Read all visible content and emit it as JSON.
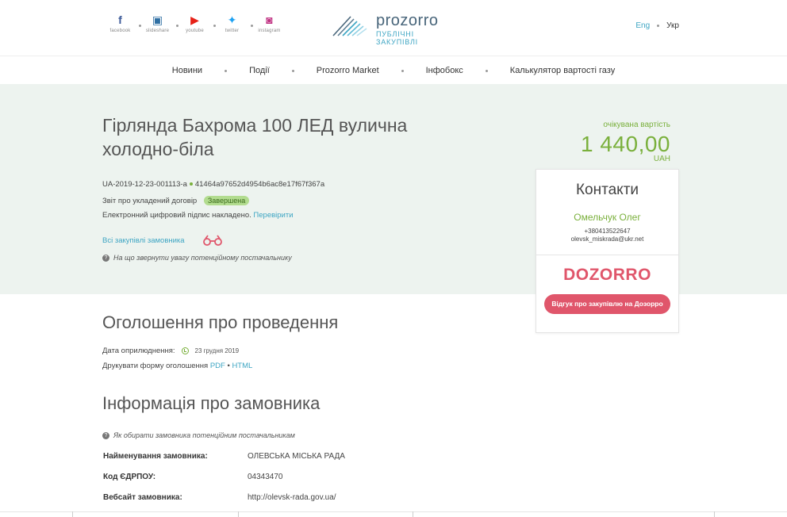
{
  "header": {
    "social": [
      {
        "icon": "facebook-icon",
        "glyph": "f",
        "label": "facebook",
        "color": "#3b5998"
      },
      {
        "icon": "slideshare-icon",
        "glyph": "▣",
        "label": "slideshare",
        "color": "#2f6fa3"
      },
      {
        "icon": "youtube-icon",
        "glyph": "▶",
        "label": "youtube",
        "color": "#e62117"
      },
      {
        "icon": "twitter-icon",
        "glyph": "✦",
        "label": "twitter",
        "color": "#1da1f2"
      },
      {
        "icon": "instagram-icon",
        "glyph": "◙",
        "label": "instagram",
        "color": "#c13584"
      }
    ],
    "logo_word": "prozorro",
    "logo_sub": "ПУБЛІЧНІ ЗАКУПІВЛІ",
    "lang_en": "Eng",
    "lang_ua": "Укр"
  },
  "nav": [
    "Новини",
    "Події",
    "Prozorro Market",
    "Інфобокс",
    "Калькулятор вартості газу"
  ],
  "tender": {
    "title": "Гірлянда Бахрома 100 ЛЕД вулична холодно-біла",
    "expected_label": "очікувана вартість",
    "amount": "1 440,00",
    "currency": "UAH",
    "id": "UA-2019-12-23-001113-a",
    "hash": "41464a97652d4954b6ac8e17f67f367a",
    "report_label": "Звіт про укладений договір",
    "status": "Завершена",
    "sign_text": "Електронний цифровий підпис накладено.",
    "sign_link": "Перевірити",
    "all_tenders": "Всі закупівлі замовника",
    "hint": "На що звернути увагу потенційному постачальнику"
  },
  "contacts": {
    "title": "Контакти",
    "name": "Омельчук Олег",
    "phone": "+380413522647",
    "email": "olevsk_miskrada@ukr.net",
    "dozorro": "DOZORRO",
    "dozorro_button": "Відгук про закупівлю на Дозорро"
  },
  "announcement": {
    "heading": "Оголошення про проведення",
    "pub_label": "Дата оприлюднення:",
    "pub_date": "23 грудня 2019",
    "print_label": "Друкувати форму оголошення",
    "pdf": "PDF",
    "html": "HTML"
  },
  "customer": {
    "heading": "Інформація про замовника",
    "hint": "Як обирати замовника потенційним постачальникам",
    "rows": [
      {
        "key": "Найменування замовника:",
        "value": "ОЛЕВСЬКА МІСЬКА РАДА"
      },
      {
        "key": "Код ЄДРПОУ:",
        "value": "04343470"
      },
      {
        "key": "Вебсайт замовника:",
        "value": "http://olevsk-rada.gov.ua/"
      }
    ]
  },
  "colors": {
    "accent_green": "#7ab03c",
    "link_blue": "#3da5c3",
    "dozorro_red": "#e0566b",
    "hero_bg": "#edf3ef"
  }
}
